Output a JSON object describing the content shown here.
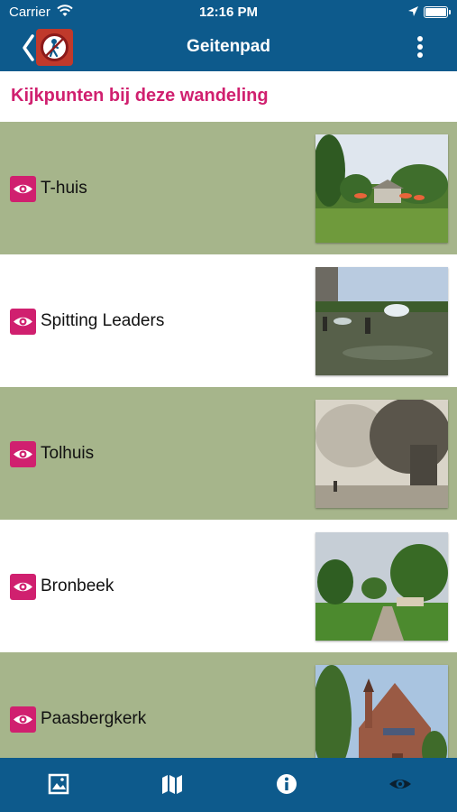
{
  "status_bar": {
    "carrier": "Carrier",
    "time": "12:16 PM",
    "icons": [
      "wifi-icon",
      "location-arrow-icon",
      "battery-icon"
    ]
  },
  "nav": {
    "title": "Geitenpad",
    "back_icon": "chevron-left-icon",
    "app_icon": "hiker-logo-icon",
    "menu_icon": "more-vertical-icon"
  },
  "section": {
    "title": "Kijkpunten bij deze wandeling"
  },
  "viewpoints": [
    {
      "label": "T-huis",
      "icon": "eye-icon",
      "image": "park-with-orange-umbrellas"
    },
    {
      "label": "Spitting Leaders",
      "icon": "eye-icon",
      "image": "pond-with-fountains-and-statues"
    },
    {
      "label": "Tolhuis",
      "icon": "eye-icon",
      "image": "historic-sepia-photo-house"
    },
    {
      "label": "Bronbeek",
      "icon": "eye-icon",
      "image": "park-path-with-trees"
    },
    {
      "label": "Paasbergkerk",
      "icon": "eye-icon",
      "image": "brick-church-with-tower"
    }
  ],
  "tab_bar": {
    "tabs": [
      {
        "name": "photos",
        "icon": "image-icon"
      },
      {
        "name": "map",
        "icon": "map-icon"
      },
      {
        "name": "info",
        "icon": "info-icon"
      },
      {
        "name": "viewpoints",
        "icon": "eye-icon",
        "selected": true
      }
    ]
  },
  "colors": {
    "bar_blue": "#0d5a8c",
    "accent_pink": "#d0206f",
    "row_green": "#a6b58b",
    "row_white": "#ffffff"
  }
}
